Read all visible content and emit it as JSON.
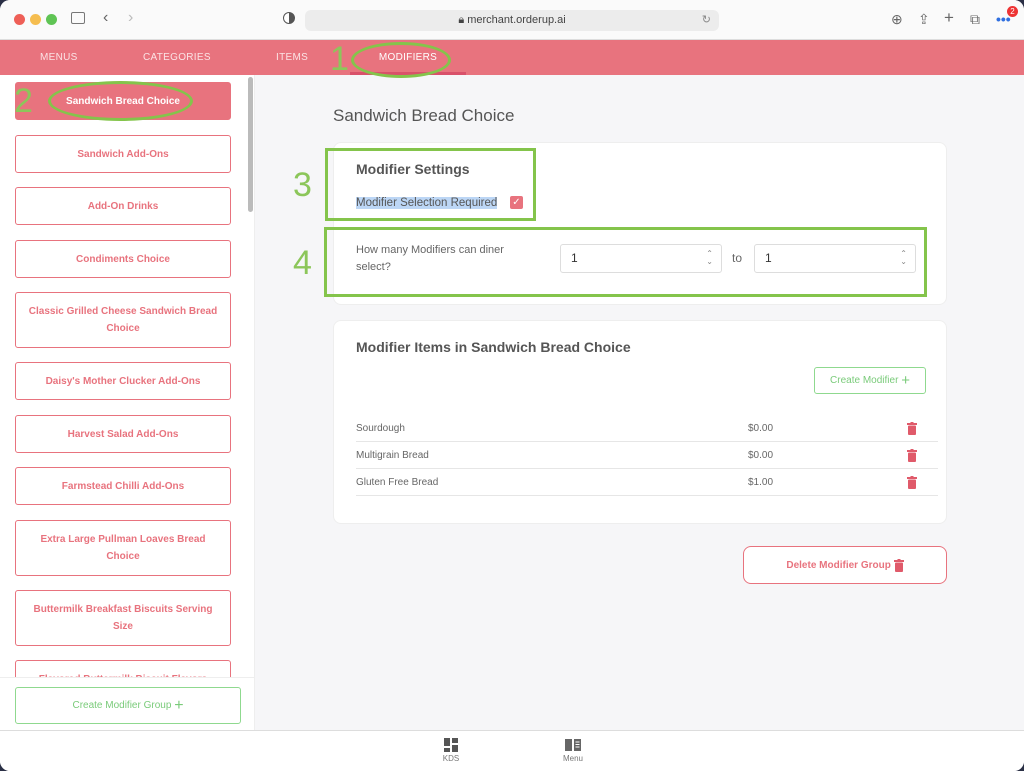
{
  "browser": {
    "url": "merchant.orderup.ai",
    "badge": "2"
  },
  "nav": {
    "tabs": [
      {
        "label": "MENUS"
      },
      {
        "label": "CATEGORIES"
      },
      {
        "label": "ITEMS"
      },
      {
        "label": "MODIFIERS",
        "active": true
      }
    ]
  },
  "sidebar": {
    "items": [
      {
        "label": "Sandwich Bread Choice",
        "active": true
      },
      {
        "label": "Sandwich Add-Ons"
      },
      {
        "label": "Add-On Drinks"
      },
      {
        "label": "Condiments Choice"
      },
      {
        "label": "Classic Grilled Cheese Sandwich Bread Choice"
      },
      {
        "label": "Daisy's Mother Clucker Add-Ons"
      },
      {
        "label": "Harvest Salad Add-Ons"
      },
      {
        "label": "Farmstead Chilli Add-Ons"
      },
      {
        "label": "Extra Large Pullman Loaves Bread Choice"
      },
      {
        "label": "Buttermilk Breakfast Biscuits Serving Size"
      },
      {
        "label": "Flavored Buttermilk Biscuit Flavors"
      }
    ],
    "create_label": "Create Modifier Group"
  },
  "main": {
    "title": "Sandwich Bread Choice",
    "settings": {
      "heading": "Modifier Settings",
      "required_label": "Modifier Selection Required",
      "required_checked": true,
      "count_label": "How many Modifiers can diner select?",
      "min": "1",
      "to_label": "to",
      "max": "1"
    },
    "items_card": {
      "heading": "Modifier Items in Sandwich Bread Choice",
      "create_label": "Create Modifier",
      "rows": [
        {
          "name": "Sourdough",
          "price": "$0.00"
        },
        {
          "name": "Multigrain Bread",
          "price": "$0.00"
        },
        {
          "name": "Gluten Free Bread",
          "price": "$1.00"
        }
      ]
    },
    "delete_label": "Delete Modifier Group"
  },
  "footer": {
    "items": [
      {
        "label": "KDS",
        "icon": "dashboard-icon"
      },
      {
        "label": "Menu",
        "icon": "book-icon"
      }
    ]
  },
  "annotations": [
    "1",
    "2",
    "3",
    "4"
  ],
  "colors": {
    "brand": "#e8737e",
    "green": "#7acb7a",
    "annotation": "#84c44b"
  }
}
